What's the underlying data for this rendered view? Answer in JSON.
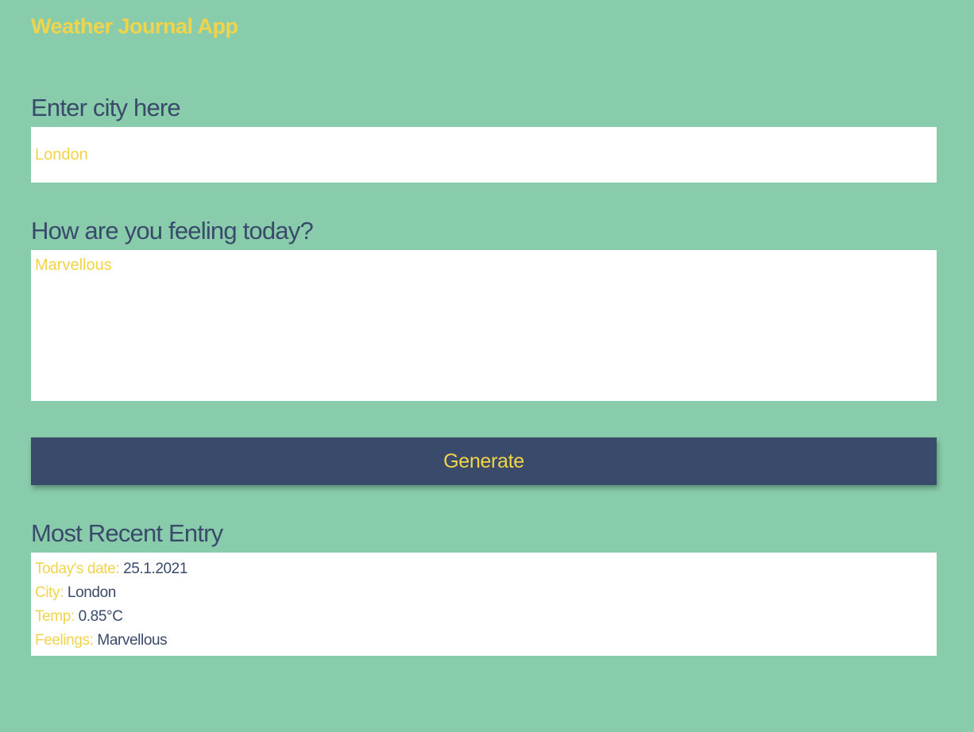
{
  "app": {
    "title": "Weather Journal App"
  },
  "city": {
    "label": "Enter city here",
    "value": "London"
  },
  "feelings": {
    "label": "How are you feeling today?",
    "value": "Marvellous"
  },
  "generate": {
    "label": "Generate"
  },
  "entry": {
    "heading": "Most Recent Entry",
    "rows": [
      {
        "key": "Today's date:",
        "value": "25.1.2021"
      },
      {
        "key": "City:",
        "value": "London"
      },
      {
        "key": "Temp:",
        "value": "0.85°C"
      },
      {
        "key": "Feelings:",
        "value": "Marvellous"
      }
    ]
  },
  "colors": {
    "background": "#88ccab",
    "accent": "#f2d44a",
    "navy": "#3a4a6b",
    "panel": "#ffffff"
  }
}
